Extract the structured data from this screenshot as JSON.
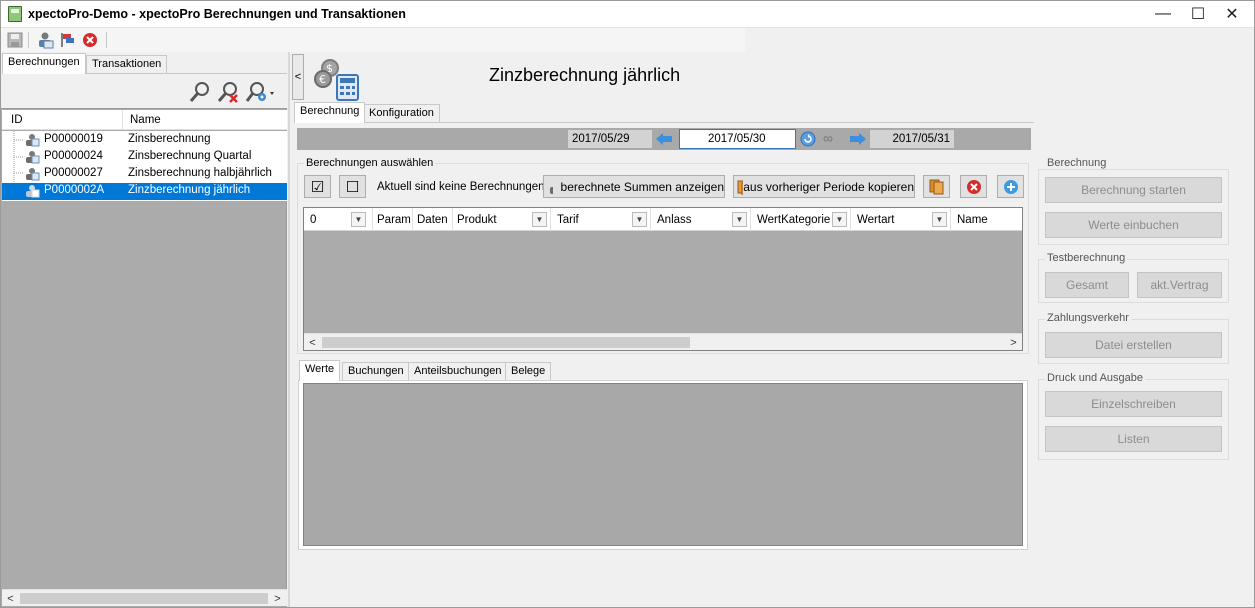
{
  "window": {
    "title": "xpectoPro-Demo - xpectoPro Berechnungen und Transaktionen",
    "controls": [
      "—",
      "☐",
      "✕"
    ]
  },
  "left": {
    "tabs": [
      {
        "label": "Berechnungen"
      },
      {
        "label": "Transaktionen"
      }
    ],
    "columns": {
      "id": "ID",
      "name": "Name"
    },
    "rows": [
      {
        "id": "P00000019",
        "name": "Zinsberechnung"
      },
      {
        "id": "P00000024",
        "name": "Zinsberechnung Quartal"
      },
      {
        "id": "P00000027",
        "name": "Zinsberechnung halbjährlich"
      },
      {
        "id": "P0000002A",
        "name": "Zinzberechnung jährlich"
      }
    ]
  },
  "collapse_label": "<",
  "main": {
    "title": "Zinzberechnung jährlich",
    "tabs": [
      {
        "label": "Berechnung"
      },
      {
        "label": "Konfiguration"
      }
    ],
    "dates": {
      "prev": "2017/05/29",
      "current": "2017/05/30",
      "next": "2017/05/31",
      "link_symbol": "∞"
    },
    "select_group": {
      "label": "Berechnungen auswählen",
      "check_all": "☑",
      "uncheck_all": "☐",
      "status": "Aktuell sind keine Berechnungen",
      "show_sums": "berechnete Summen anzeigen",
      "copy_prev": "aus vorheriger Periode kopieren"
    },
    "grid_columns": [
      "0",
      "Param",
      "Daten",
      "Produkt",
      "Tarif",
      "Anlass",
      "WertKategorie",
      "Wertart",
      "Name"
    ],
    "bottom_tabs": [
      {
        "label": "Werte"
      },
      {
        "label": "Buchungen"
      },
      {
        "label": "Anteilsbuchungen"
      },
      {
        "label": "Belege"
      }
    ]
  },
  "right": {
    "berechnung": {
      "label": "Berechnung",
      "start": "Berechnung starten",
      "book": "Werte einbuchen"
    },
    "test": {
      "label": "Testberechnung",
      "total": "Gesamt",
      "contract": "akt.Vertrag"
    },
    "payment": {
      "label": "Zahlungsverkehr",
      "create_file": "Datei erstellen"
    },
    "print": {
      "label": "Druck und Ausgabe",
      "single": "Einzelschreiben",
      "lists": "Listen"
    }
  },
  "colors": {
    "selection": "#0078d7",
    "panel_gray": "#ababab",
    "date_bar": "#a9a9a9"
  }
}
